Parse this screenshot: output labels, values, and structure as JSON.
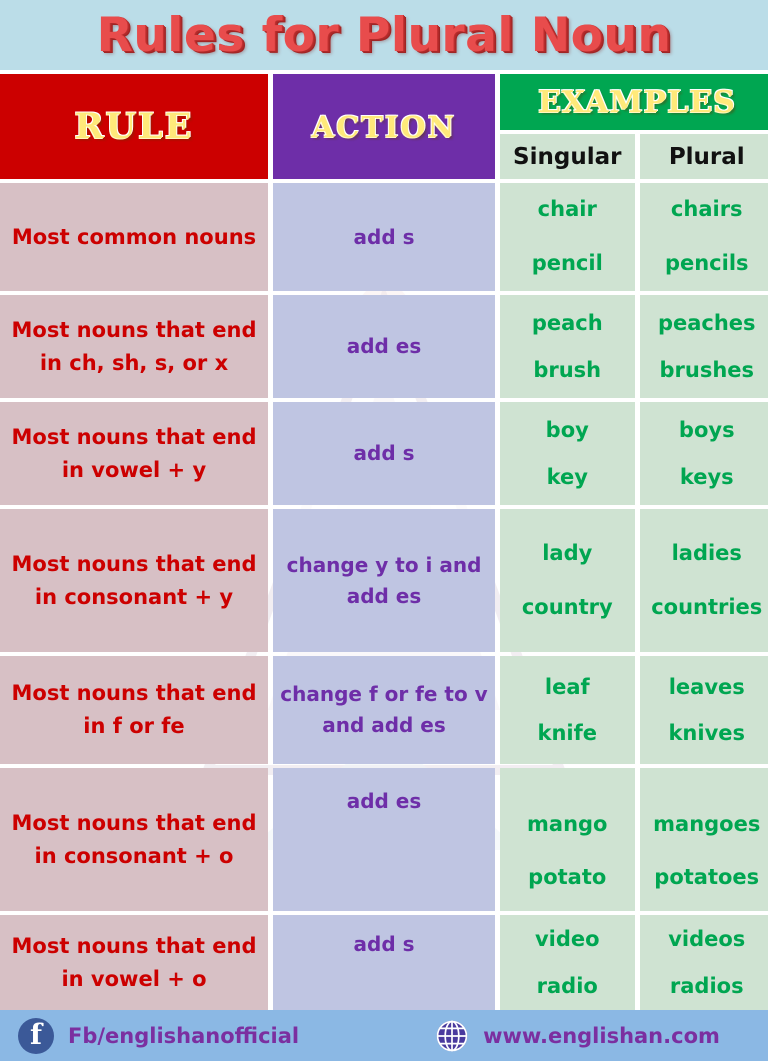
{
  "title": "Rules for Plural Noun",
  "colors": {
    "title_banner_bg": "#bbdde8",
    "title_text": "#e84c4c",
    "rule_header_bg": "#cc0000",
    "action_header_bg": "#6e2ea8",
    "examples_header_bg": "#00a651",
    "header_text": "#ffe97a",
    "rule_cell_bg": "#d7c0c5",
    "action_cell_bg": "#bfc5e2",
    "example_cell_bg": "#cfe3d2",
    "rule_text": "#cc0000",
    "action_text": "#6e2ea8",
    "example_text": "#00a651",
    "footer_bg": "#8bb8e4",
    "footer_text": "#7b2fa0"
  },
  "table": {
    "headers": {
      "rule": "RULE",
      "action": "ACTION",
      "examples": "EXAMPLES",
      "singular": "Singular",
      "plural": "Plural"
    },
    "rows": [
      {
        "rule": "Most common nouns",
        "action": "add s",
        "singular": "chair\npencil",
        "plural": "chairs\npencils"
      },
      {
        "rule": "Most nouns that end in ch, sh, s, or x",
        "action": "add es",
        "singular": "peach\nbrush",
        "plural": "peaches\nbrushes"
      },
      {
        "rule": "Most nouns that end in vowel + y",
        "action": "add s",
        "singular": "boy\nkey",
        "plural": "boys\nkeys"
      },
      {
        "rule": "Most nouns that end in consonant + y",
        "action": "change y to i and add es",
        "singular": "lady\ncountry",
        "plural": "ladies\ncountries"
      },
      {
        "rule": "Most nouns that end in f or fe",
        "action": "change f or fe to v and add es",
        "singular": "leaf\nknife",
        "plural": "leaves\nknives"
      },
      {
        "rule": "Most nouns that end in consonant + o",
        "action": "add es",
        "singular": "mango\npotato",
        "plural": "mangoes\npotatoes"
      },
      {
        "rule": "Most nouns that end in vowel + o",
        "action": "add s",
        "singular": "video\nradio",
        "plural": "videos\nradios"
      }
    ]
  },
  "footer": {
    "facebook_label": "Fb/englishanofficial",
    "website_label": "www.englishan.com"
  }
}
